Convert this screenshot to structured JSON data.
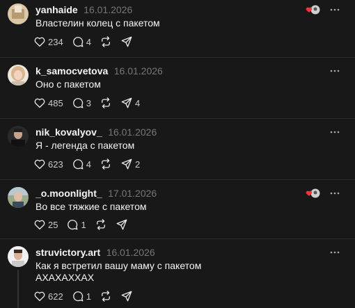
{
  "posts": [
    {
      "username": "yanhaide",
      "date": "16.01.2026",
      "text": "Властелин колец с пакетом",
      "likes": "234",
      "replies": "4",
      "reposts": "",
      "shares": "",
      "liked_badge": true,
      "avatar_color": "#d9c7a8"
    },
    {
      "username": "k_samocvetova",
      "date": "16.01.2026",
      "text": "Оно с пакетом",
      "likes": "485",
      "replies": "3",
      "reposts": "",
      "shares": "4",
      "liked_badge": false,
      "avatar_color": "#c9a989"
    },
    {
      "username": "nik_kovalyov_",
      "date": "16.01.2026",
      "text": "Я - легенда с пакетом",
      "likes": "623",
      "replies": "4",
      "reposts": "",
      "shares": "2",
      "liked_badge": false,
      "avatar_color": "#3a3a3a"
    },
    {
      "username": "_o.moonlight_",
      "date": "17.01.2026",
      "text": "Во все тяжкие с пакетом",
      "likes": "25",
      "replies": "1",
      "reposts": "",
      "shares": "",
      "liked_badge": true,
      "avatar_color": "#7b8f6a"
    },
    {
      "username": "struvictory.art",
      "date": "16.01.2026",
      "text_line1": "Как я встретил вашу маму с пакетом",
      "text_line2": "АХАХАХХАХ",
      "likes": "622",
      "replies": "1",
      "reposts": "",
      "shares": "",
      "liked_badge": false,
      "avatar_color": "#e6e6e6"
    }
  ],
  "icons": {
    "like": "heart-icon",
    "reply": "comment-icon",
    "repost": "repost-icon",
    "share": "send-icon",
    "more": "more-icon",
    "liked_badge": "liked-by-creator-badge"
  },
  "colors": {
    "background": "#181818",
    "text": "#f3f5f7",
    "muted": "#777777",
    "heart_red": "#ff3040"
  }
}
